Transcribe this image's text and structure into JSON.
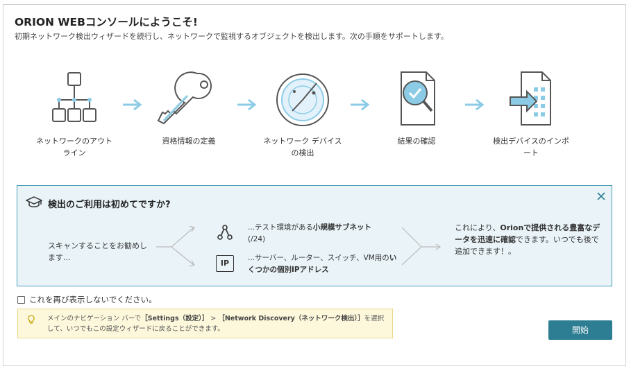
{
  "header": {
    "title": "ORION WEBコンソールにようこそ!",
    "subtitle": "初期ネットワーク検出ウィザードを続行し、ネットワークで監視するオブジェクトを検出します。次の手順をサポートします。"
  },
  "steps": [
    {
      "label": "ネットワークのアウトライン",
      "icon": "network-outline-icon"
    },
    {
      "label": "資格情報の定義",
      "icon": "key-icon"
    },
    {
      "label": "ネットワーク デバイスの検出",
      "icon": "radar-icon"
    },
    {
      "label": "結果の確認",
      "icon": "document-check-icon"
    },
    {
      "label": "検出デバイスのインポート",
      "icon": "import-icon"
    }
  ],
  "info": {
    "title": "検出のご利用は初めてですか?",
    "scan_text": "スキャンすることをお勧めします...",
    "option1_pre": "...テスト環境がある",
    "option1_bold": "小規模サブネット",
    "option1_post": "(/24)",
    "option2_pre": "...サーバー、ルーター、スイッチ、VM用の",
    "option2_bold": "いくつかの個別IPアドレス",
    "ip_badge": "IP",
    "result_pre": "これにより、",
    "result_bold": "Orionで提供される豊富なデータを迅速に確認",
    "result_post": "できます。いつでも後で追加できます！。"
  },
  "checkbox": {
    "label": "これを再び表示しないでください。",
    "checked": false
  },
  "hint": {
    "pre": "メインのナビゲーション バーで",
    "bold1": "［Settings（設定）］",
    "mid": " > ",
    "bold2": "［Network Discovery（ネットワーク検出）］",
    "post": "を選択して、いつでもこの設定ウィザードに戻ることができます。"
  },
  "buttons": {
    "start": "開始"
  },
  "colors": {
    "accent": "#2d7d93",
    "info_bg": "#e9f3f8",
    "info_border": "#4a9fb7",
    "hint_bg": "#fdf8dc",
    "arrow": "#8ccbe6"
  }
}
